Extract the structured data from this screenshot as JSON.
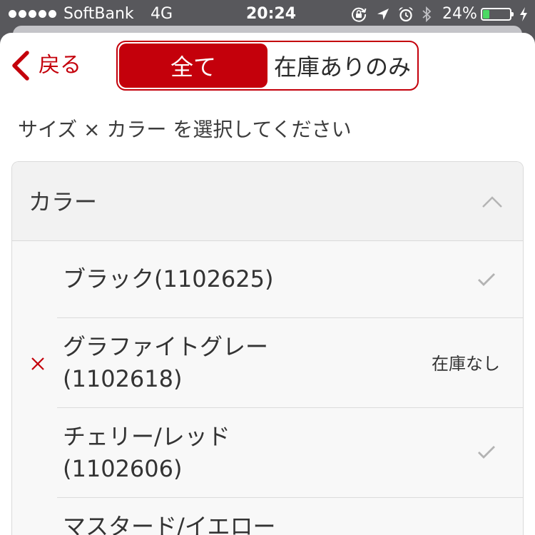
{
  "status_bar": {
    "signal_strength": 5,
    "signal_max": 5,
    "carrier": "SoftBank",
    "network": "4G",
    "time": "20:24",
    "icons": [
      "rotation-lock-icon",
      "location-arrow-icon",
      "alarm-icon",
      "bluetooth-icon"
    ],
    "battery_text": "24%",
    "battery_level": 0.24,
    "charging": true
  },
  "nav": {
    "back_icon": "chevron-left-icon",
    "back_label": "戻る",
    "segments": [
      {
        "label": "全て",
        "selected": true
      },
      {
        "label": "在庫ありのみ",
        "selected": false
      }
    ]
  },
  "instruction": "サイズ × カラー を選択してください",
  "color_panel": {
    "title": "カラー",
    "expanded": true,
    "toggle_icon": "chevron-up-icon",
    "items": [
      {
        "lines": [
          "ブラック(1102625)"
        ],
        "checked": true,
        "trailing_icon": "checkmark-icon"
      },
      {
        "lines": [
          "グラファイトグレー",
          "(1102618)"
        ],
        "unavailable": true,
        "leading_icon": "unavailable-x-icon",
        "status": "在庫なし"
      },
      {
        "lines": [
          "チェリー/レッド",
          "(1102606)"
        ],
        "checked": true,
        "trailing_icon": "checkmark-icon"
      },
      {
        "lines": [
          "マスタード/イエロー"
        ]
      }
    ]
  },
  "colors": {
    "accent": "#c4000b",
    "status_bar_bg": "#58585c",
    "panel_header_bg": "#f2f2f2",
    "list_bg": "#f8f8f8",
    "checkmark": "#b3b3b3",
    "battery_fill": "#4cd964"
  }
}
